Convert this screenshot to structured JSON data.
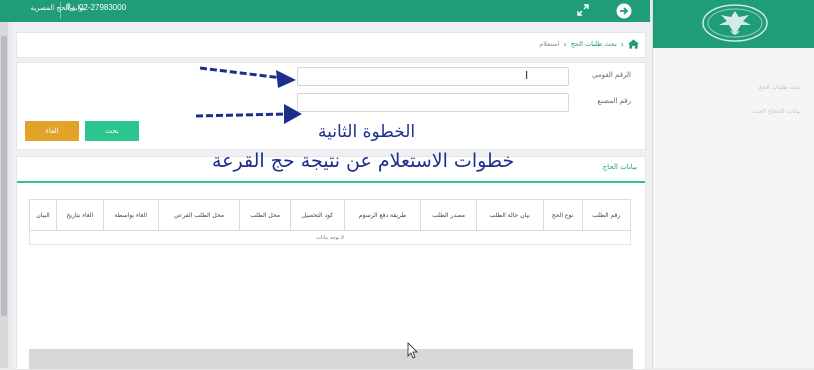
{
  "topbar": {
    "portal_name": "بوابة الحج المصرية",
    "phone": "02-27983000",
    "icons": [
      "phone-icon",
      "expand-icon",
      "arrow-circle-icon"
    ]
  },
  "sidebar": {
    "items": [
      {
        "label": "بحث طلبات الحج"
      },
      {
        "label": "بيانات الحجاج الجدد"
      }
    ]
  },
  "breadcrumb": {
    "parent": "بحث طلبات الحج",
    "current": "استعلام"
  },
  "form": {
    "national_id_label": "الرقم القومي",
    "national_id_value": "",
    "factory_number_label": "رقم المصنع",
    "factory_number_value": "",
    "search_button": "بحث",
    "cancel_button": "الغاء"
  },
  "overlay": {
    "line1": "الخطوة الثانية",
    "line2": "خطوات الاستعلام عن نتيجة حج القرعة"
  },
  "results": {
    "section_title": "بيانات الحاج",
    "columns": [
      "رقم الطلب",
      "نوع الحج",
      "بيان حالة الطلب",
      "مصدر الطلب",
      "طريقة دفع الرسوم",
      "كود التحصيل",
      "محل الطلب",
      "محل الطلب الفرعي",
      "الغاء بواسطة",
      "الغاء بتاريخ",
      "البيان"
    ],
    "empty_message": "لا توجد بيانات"
  },
  "colors": {
    "brand_green": "#1f9c78",
    "button_green": "#2cc58d",
    "button_orange": "#e2a32a",
    "annotation_blue": "#1d2f8c"
  }
}
